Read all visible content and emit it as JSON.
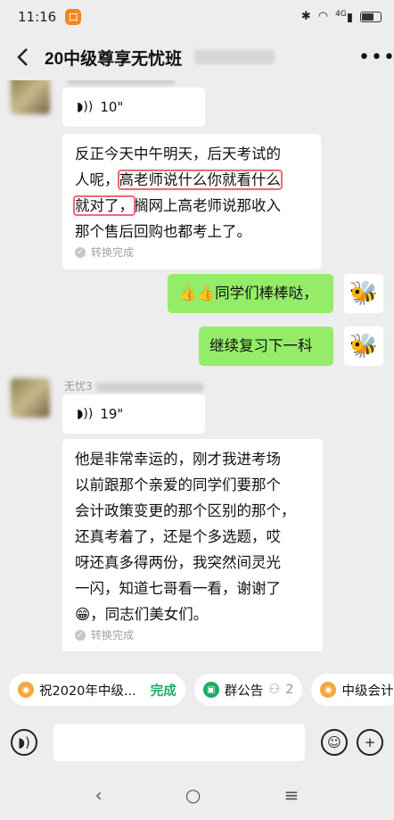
{
  "status_bar": {
    "time": "11:16",
    "app_badge": "口",
    "signal": "4G",
    "icons": [
      "bluetooth-icon",
      "wifi-icon",
      "signal-icon",
      "battery-icon"
    ]
  },
  "header": {
    "title": "20中级尊享无忧班",
    "more": "•••"
  },
  "messages": [
    {
      "voice": "10\"",
      "text": "反正今天中午明天，后天考试的人呢，高老师说什么你就看什么就对了，搁网上高老师说那收入那个售后回购也都考上了。",
      "text_parts": [
        "反正今天中午明天，后天考试的",
        "人呢，",
        "高老师说什么你就看什么",
        "就对了，",
        "搁网上高老师说那收入",
        "那个售后回购也都考上了。"
      ],
      "convert": "转换完成"
    },
    {
      "self": true,
      "emoji": "👍👍",
      "text": "同学们棒棒哒，"
    },
    {
      "self": true,
      "text": "继续复习下一科"
    },
    {
      "sender": "无忧3",
      "voice": "19\"",
      "text_lines": [
        "他是非常幸运的，刚才我进考场",
        "以前跟那个亲爱的同学们要那个",
        "会计政策变更的那个区别的那个，",
        "还真考着了，还是个多选题，哎",
        "呀还真多得两份，我突然间灵光",
        "一闪，知道七哥看一看，谢谢了"
      ],
      "last_line_emoji": "😁",
      "last_line": "，同志们美女们。",
      "convert": "转换完成"
    }
  ],
  "bottom_chips": [
    {
      "label": "祝2020年中级...",
      "status": "完成"
    },
    {
      "label": "群公告",
      "count": "2"
    },
    {
      "label": "中级会计"
    }
  ],
  "nav": {
    "back": "‹",
    "home": "○",
    "recent": "≡"
  }
}
